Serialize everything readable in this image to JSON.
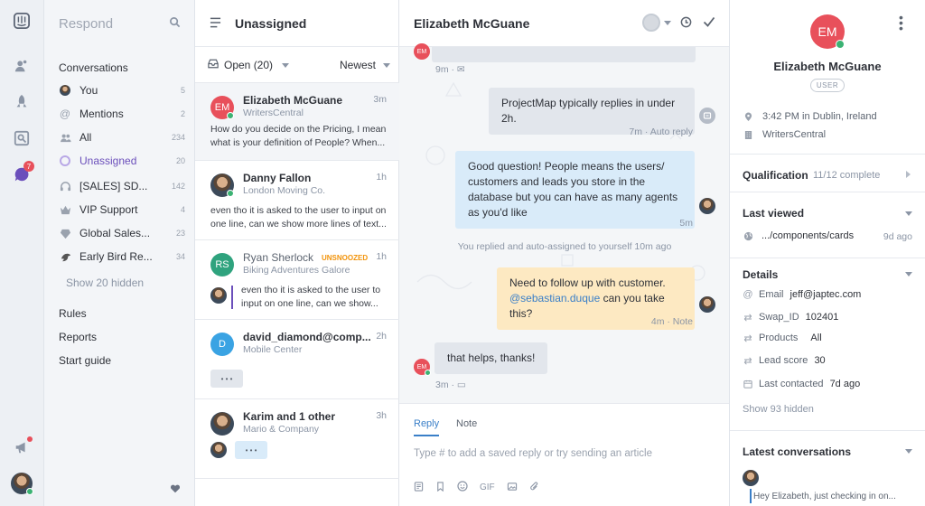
{
  "rail": {
    "notif_badge": "7"
  },
  "nav": {
    "title": "Respond",
    "conversations_label": "Conversations",
    "items": [
      {
        "label": "You",
        "count": "5",
        "icon": "user-avatar-icon"
      },
      {
        "label": "Mentions",
        "count": "2",
        "icon": "at-icon"
      },
      {
        "label": "All",
        "count": "234",
        "icon": "people-icon"
      },
      {
        "label": "Unassigned",
        "count": "20",
        "icon": "unassigned-avatar-icon"
      },
      {
        "label": "[SALES] SD...",
        "count": "142",
        "icon": "headset-icon"
      },
      {
        "label": "VIP Support",
        "count": "4",
        "icon": "crown-icon"
      },
      {
        "label": "Global Sales...",
        "count": "23",
        "icon": "diamond-icon"
      },
      {
        "label": "Early Bird Re...",
        "count": "34",
        "icon": "bird-icon"
      }
    ],
    "show_hidden": "Show 20 hidden",
    "links": [
      "Rules",
      "Reports",
      "Start guide"
    ]
  },
  "list": {
    "title": "Unassigned",
    "filter_label": "Open (20)",
    "sort_label": "Newest",
    "conversations": [
      {
        "name": "Elizabeth McGuane",
        "initials": "EM",
        "company": "WritersCentral",
        "time": "3m",
        "preview": "How do you decide on the Pricing, I mean what is your definition of People? When..."
      },
      {
        "name": "Danny Fallon",
        "company": "London Moving Co.",
        "time": "1h",
        "preview": "even tho it is asked to the user to input on one line, can we show more lines of text..."
      },
      {
        "name": "Ryan Sherlock",
        "initials": "RS",
        "badge": "UNSNOOZED",
        "company": "Biking Adventures Galore",
        "time": "1h",
        "preview": "even tho it is asked to the user to input on one line, can we show..."
      },
      {
        "name": "david_diamond@comp...",
        "initials": "D",
        "company": "Mobile Center",
        "time": "2h",
        "preview": "• • •"
      },
      {
        "name": "Karim and 1 other",
        "company": "Mario & Company",
        "time": "3h",
        "preview": "• • •"
      }
    ]
  },
  "chat": {
    "title": "Elizabeth McGuane",
    "messages": [
      {
        "meta": "9m ·"
      },
      {
        "text": "ProjectMap typically replies in under 2h.",
        "meta": "7m · Auto reply"
      },
      {
        "text": "Good question! People means the users/ customers and leads you store in the database but you can have as many agents as you'd like",
        "meta": "5m"
      },
      {
        "event": "You replied and auto-assigned to yourself 10m ago"
      },
      {
        "text_before": "Need to follow up with customer.",
        "mention": "@sebastian.duque",
        "text_after": " can you take this?",
        "meta": "4m · Note"
      },
      {
        "text": "that helps, thanks!",
        "meta": "3m ·"
      }
    ],
    "composer": {
      "tab_reply": "Reply",
      "tab_note": "Note",
      "placeholder": "Type # to add a saved reply or try sending an article",
      "gif_label": "GIF"
    }
  },
  "details": {
    "initials": "EM",
    "name": "Elizabeth McGuane",
    "role_badge": "USER",
    "local_time": "3:42 PM in Dublin, Ireland",
    "company": "WritersCentral",
    "qualification": {
      "label": "Qualification",
      "value": "11/12 complete"
    },
    "last_viewed": {
      "label": "Last viewed",
      "page": ".../components/cards",
      "time": "9d ago"
    },
    "attributes_title": "Details",
    "attributes": [
      {
        "label": "Email",
        "value": "jeff@japtec.com"
      },
      {
        "label": "Swap_ID",
        "value": "102401"
      },
      {
        "label": "Products",
        "value": "All"
      },
      {
        "label": "Lead score",
        "value": "30"
      },
      {
        "label": "Last contacted",
        "value": "7d ago"
      }
    ],
    "show_hidden": "Show 93 hidden",
    "latest_title": "Latest conversations",
    "latest_preview": "Hey Elizabeth, just checking in on..."
  },
  "colors": {
    "accent": "#6b4fbb",
    "initials_red": "#e8505b",
    "green": "#3bb273",
    "bubble_blue": "#d9ebf9",
    "note_yellow": "#fde9c2"
  }
}
